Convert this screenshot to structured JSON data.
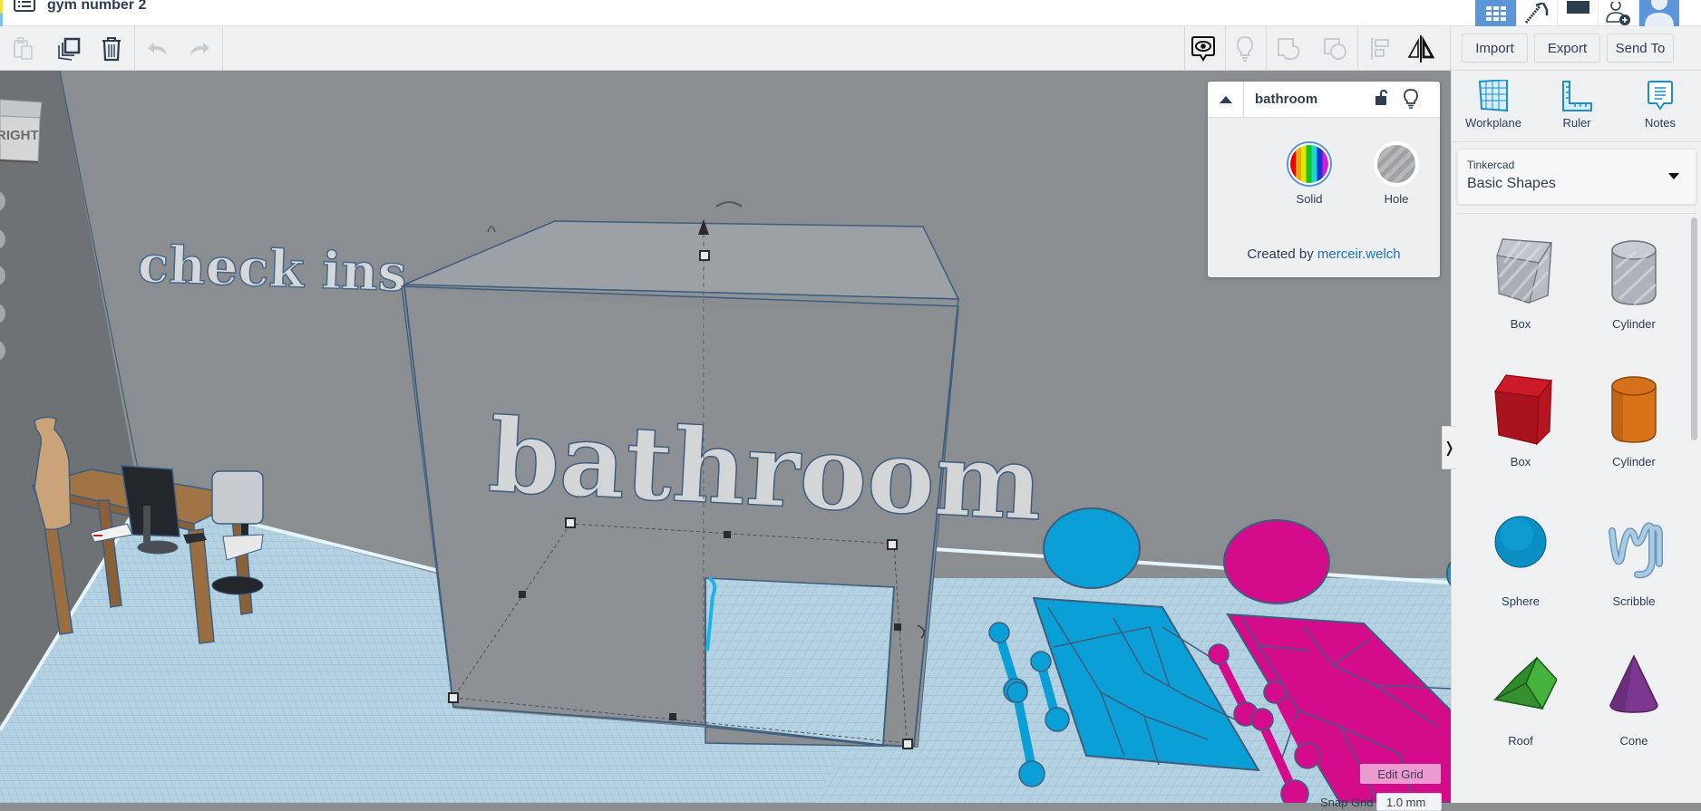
{
  "app": {
    "document_title": "gym number 2"
  },
  "topbar": {
    "buttons": [
      {
        "name": "3d-design-view",
        "icon": "grid-icon",
        "active": true
      },
      {
        "name": "blocks-view",
        "icon": "pickaxe-icon"
      },
      {
        "name": "lessons-view",
        "icon": "square-icon"
      },
      {
        "name": "invite-user",
        "icon": "add-user-icon"
      },
      {
        "name": "profile",
        "icon": "avatar-icon"
      }
    ]
  },
  "toolbar": {
    "left_tools": [
      {
        "name": "paste",
        "icon": "clipboard-icon",
        "enabled": false
      },
      {
        "name": "duplicate",
        "icon": "duplicate-icon",
        "enabled": true
      },
      {
        "name": "delete",
        "icon": "trash-icon",
        "enabled": true
      },
      {
        "name": "undo",
        "icon": "undo-icon",
        "enabled": false
      },
      {
        "name": "redo",
        "icon": "redo-icon",
        "enabled": false
      }
    ],
    "right_tools": [
      {
        "name": "notes-visibility",
        "icon": "eye-comment-icon",
        "enabled": true
      },
      {
        "name": "show-all",
        "icon": "lightbulb-icon",
        "enabled": false
      },
      {
        "name": "group",
        "icon": "group-icon",
        "enabled": false
      },
      {
        "name": "ungroup",
        "icon": "ungroup-icon",
        "enabled": false
      },
      {
        "name": "align",
        "icon": "align-icon",
        "enabled": false
      },
      {
        "name": "mirror",
        "icon": "mirror-icon",
        "enabled": true
      }
    ],
    "import_label": "Import",
    "export_label": "Export",
    "send_to_label": "Send To"
  },
  "viewcube": {
    "face_label": "RIGHT"
  },
  "scene": {
    "selected_object_text": "bathroom",
    "wall_text": "check ins",
    "colors": {
      "blue_objects": "#0a9fd6",
      "pink_objects": "#d40c8c",
      "workplane": "#b9d6e6",
      "wall": "#8a8e91"
    }
  },
  "inspector": {
    "object_name": "bathroom",
    "solid_label": "Solid",
    "hole_label": "Hole",
    "created_by_prefix": "Created by",
    "author": "merceir.welch"
  },
  "right_panel": {
    "tools": [
      {
        "label": "Workplane",
        "icon": "workplane-icon"
      },
      {
        "label": "Ruler",
        "icon": "ruler-icon"
      },
      {
        "label": "Notes",
        "icon": "notes-icon"
      }
    ],
    "library_provider": "Tinkercad",
    "library_name": "Basic Shapes",
    "shapes": [
      {
        "label": "Box",
        "kind": "box-hole"
      },
      {
        "label": "Cylinder",
        "kind": "cylinder-hole"
      },
      {
        "label": "Box",
        "kind": "box-red"
      },
      {
        "label": "Cylinder",
        "kind": "cylinder-orange"
      },
      {
        "label": "Sphere",
        "kind": "sphere-blue"
      },
      {
        "label": "Scribble",
        "kind": "scribble"
      },
      {
        "label": "Roof",
        "kind": "roof-green"
      },
      {
        "label": "Cone",
        "kind": "cone-purple"
      }
    ]
  },
  "grid": {
    "edit_grid_label": "Edit Grid",
    "snap_grid_label": "Snap Grid",
    "snap_grid_value": "1.0 mm"
  }
}
